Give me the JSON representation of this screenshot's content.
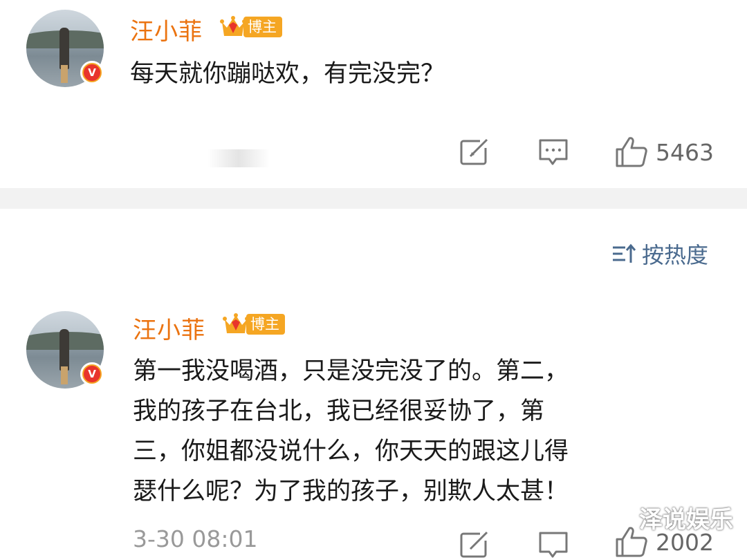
{
  "first_comment": {
    "username": "汪小菲",
    "badge": "博主",
    "verified_mark": "V",
    "text": "每天就你蹦哒欢，有完没完？",
    "like_count": "5463"
  },
  "sort": {
    "label": "按热度",
    "icon": "sort-icon"
  },
  "second_comment": {
    "username": "汪小菲",
    "badge": "博主",
    "verified_mark": "V",
    "lines": [
      "第一我没喝酒，只是没完没了的。第二，",
      "我的孩子在台北，我已经很妥协了，第",
      "三，你姐都没说什么，你天天的跟这儿得",
      "瑟什么呢？为了我的孩子，别欺人太甚！"
    ],
    "time": "3-30 08:01",
    "like_count": "2002"
  },
  "watermark": "泽说娱乐",
  "colors": {
    "username": "#eb7310",
    "badge": "#f5a623",
    "link": "#4a6a8e",
    "icon": "#777777"
  }
}
